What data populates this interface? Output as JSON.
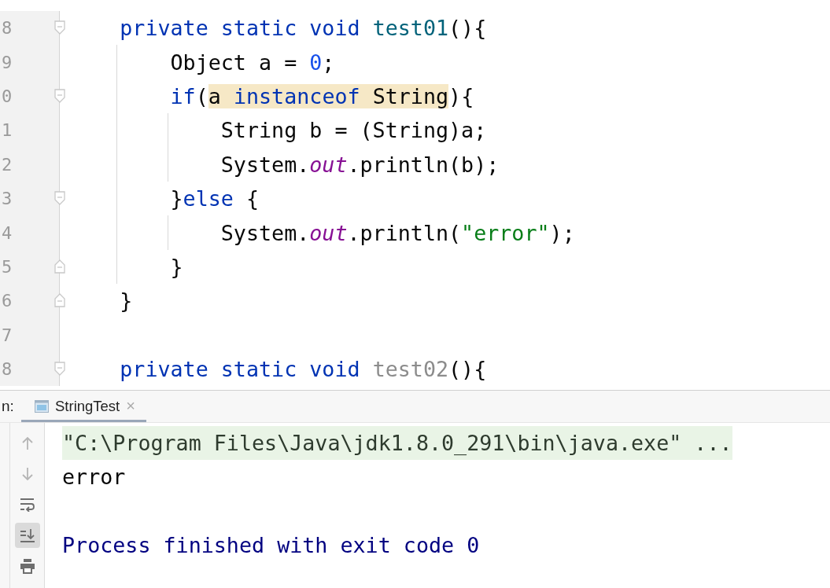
{
  "editor": {
    "lines": [
      {
        "number": "8",
        "fold_start": true,
        "tokens": [
          {
            "text": "    private static void ",
            "kind": "keyword"
          },
          {
            "text": "test01",
            "kind": "method"
          },
          {
            "text": "(){",
            "kind": "plain"
          }
        ]
      },
      {
        "number": "9",
        "tokens": [
          {
            "text": "        Object a = ",
            "kind": "plain"
          },
          {
            "text": "0",
            "kind": "number"
          },
          {
            "text": ";",
            "kind": "plain"
          }
        ]
      },
      {
        "number": "0",
        "fold_start": true,
        "tokens": [
          {
            "text": "        if",
            "kind": "keyword"
          },
          {
            "text": "(",
            "kind": "plain"
          },
          {
            "text": "a ",
            "kind": "plain",
            "highlight": true
          },
          {
            "text": "instanceof",
            "kind": "keyword",
            "highlight": true
          },
          {
            "text": " String",
            "kind": "plain",
            "highlight": true
          },
          {
            "text": "){",
            "kind": "plain"
          }
        ]
      },
      {
        "number": "1",
        "tokens": [
          {
            "text": "            String b = (String)a;",
            "kind": "plain"
          }
        ]
      },
      {
        "number": "2",
        "tokens": [
          {
            "text": "            System.",
            "kind": "plain"
          },
          {
            "text": "out",
            "kind": "field"
          },
          {
            "text": ".println(b);",
            "kind": "plain"
          }
        ]
      },
      {
        "number": "3",
        "fold_start": true,
        "tokens": [
          {
            "text": "        }",
            "kind": "plain"
          },
          {
            "text": "else",
            "kind": "keyword"
          },
          {
            "text": " {",
            "kind": "plain"
          }
        ]
      },
      {
        "number": "4",
        "tokens": [
          {
            "text": "            System.",
            "kind": "plain"
          },
          {
            "text": "out",
            "kind": "field"
          },
          {
            "text": ".println(",
            "kind": "plain"
          },
          {
            "text": "\"error\"",
            "kind": "string"
          },
          {
            "text": ");",
            "kind": "plain"
          }
        ]
      },
      {
        "number": "5",
        "fold_end": true,
        "tokens": [
          {
            "text": "        }",
            "kind": "plain"
          }
        ]
      },
      {
        "number": "6",
        "fold_end": true,
        "tokens": [
          {
            "text": "    }",
            "kind": "plain"
          }
        ]
      },
      {
        "number": "7"
      },
      {
        "number": "8",
        "fold_start": true,
        "tokens": [
          {
            "text": "    private static void ",
            "kind": "keyword"
          },
          {
            "text": "test02",
            "kind": "unused"
          },
          {
            "text": "(){",
            "kind": "plain"
          }
        ]
      }
    ]
  },
  "run_panel": {
    "label": "n:",
    "tabs": [
      {
        "label": "StringTest",
        "close": "×",
        "selected": true
      }
    ],
    "toolbar": [
      {
        "kind": "up",
        "disabled": true,
        "selected": false
      },
      {
        "kind": "down",
        "disabled": true,
        "selected": false
      },
      {
        "kind": "wrap",
        "disabled": false,
        "selected": false
      },
      {
        "kind": "scroll_end",
        "disabled": false,
        "selected": true
      },
      {
        "kind": "print",
        "disabled": false,
        "selected": false
      }
    ],
    "console": [
      {
        "kind": "command",
        "text": "\"C:\\Program Files\\Java\\jdk1.8.0_291\\bin\\java.exe\" ..."
      },
      {
        "kind": "output",
        "text": "error"
      },
      {
        "kind": "exit",
        "text": "Process finished with exit code 0"
      }
    ]
  }
}
